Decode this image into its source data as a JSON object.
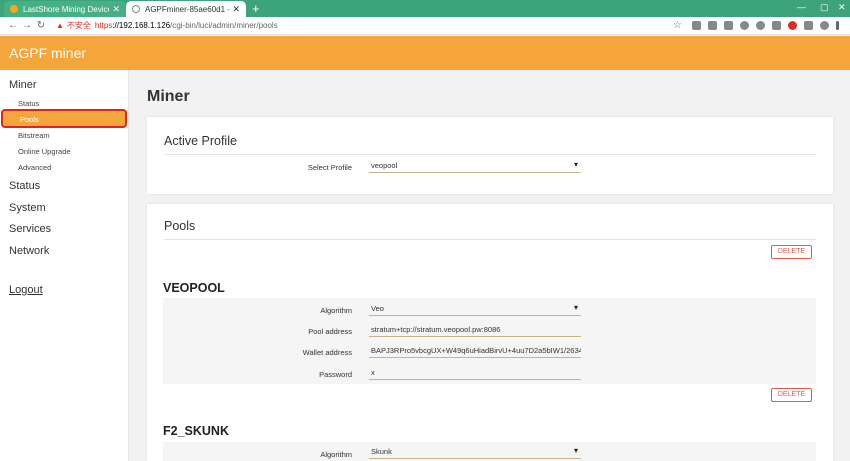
{
  "browser": {
    "tabs": [
      {
        "title": "LastShore Mining Devices",
        "close": "✕"
      },
      {
        "title": "AGPFminer-85ae60d1 - Pools",
        "close": "✕"
      }
    ],
    "new_tab": "+",
    "security_label": "不安全",
    "url_scheme": "https",
    "url_host": "://192.168.1.126",
    "url_path": "/cgi-bin/luci/admin/miner/pools"
  },
  "app": {
    "brand": "AGPF miner"
  },
  "sidebar": {
    "groups": [
      {
        "label": "Miner"
      },
      {
        "label": "Status"
      },
      {
        "label": "System"
      },
      {
        "label": "Services"
      },
      {
        "label": "Network"
      }
    ],
    "miner_items": [
      {
        "label": "Status"
      },
      {
        "label": "Pools"
      },
      {
        "label": "Bitstream"
      },
      {
        "label": "Online Upgrade"
      },
      {
        "label": "Advanced"
      }
    ],
    "logout": "Logout"
  },
  "main": {
    "title": "Miner",
    "active_profile": {
      "title": "Active Profile",
      "label": "Select Profile",
      "value": "veopool"
    },
    "pools": {
      "title": "Pools",
      "delete_label": "DELETE",
      "items": [
        {
          "name": "VEOPOOL",
          "algorithm_label": "Algorithm",
          "algorithm": "Veo",
          "pool_address_label": "Pool address",
          "pool_address": "stratum+tcp://stratum.veopool.pw:8086",
          "wallet_label": "Wallet address",
          "wallet": "BAPJ3RPro5vbcgUX+W49q6uHiadBirvU+4uu7D2a5bIW1/26344c8pjY",
          "password_label": "Password",
          "password": "x"
        },
        {
          "name": "F2_SKUNK",
          "algorithm_label": "Algorithm",
          "algorithm": "Skunk"
        }
      ]
    }
  },
  "colors": {
    "accent": "#f4a53c",
    "tabstrip": "#3ca37a",
    "highlight_border": "#e0261c",
    "delete": "#e05a4f"
  }
}
